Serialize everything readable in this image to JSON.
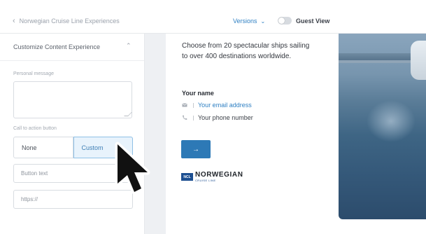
{
  "topbar": {
    "back_label": "Norwegian Cruise Line Experiences",
    "versions_label": "Versions",
    "guest_view_label": "Guest View",
    "guest_view_on": false
  },
  "panel": {
    "title": "Customize Content Experience",
    "personal_message_label": "Personal message",
    "cta_label": "Call to action button",
    "cta_options": [
      "None",
      "Custom"
    ],
    "cta_selected": "Custom",
    "button_text_placeholder": "Button text",
    "url_placeholder": "https://"
  },
  "preview": {
    "headline": "Choose from 20 spectacular ships sailing to over 400 destinations worldwide.",
    "name_label": "Your name",
    "email_label": "Your email address",
    "phone_label": "Your phone number",
    "cta_glyph": "→",
    "logo_badge": "NCL",
    "logo_main": "NORWEGIAN",
    "logo_sub": "CRUISE LINE"
  },
  "colors": {
    "accent": "#2f80c3",
    "cta_button": "#2d79b6",
    "selected_bg": "#e8f3fc"
  }
}
